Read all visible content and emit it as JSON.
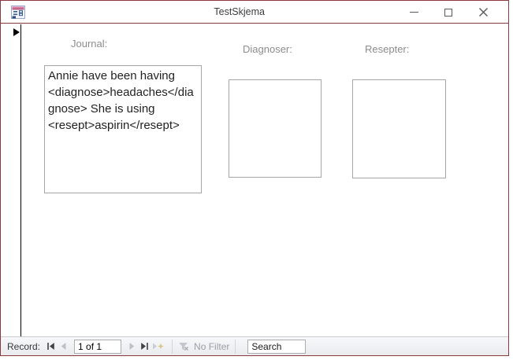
{
  "window": {
    "title": "TestSkjema",
    "controls": {
      "minimize": "minimize",
      "maximize": "maximize",
      "close": "close"
    }
  },
  "form": {
    "journal": {
      "label": "Journal:",
      "value": "Annie have been having <diagnose>headaches</diagnose> She is using <resept>aspirin</resept>"
    },
    "diagnoser": {
      "label": "Diagnoser:",
      "items": []
    },
    "resepter": {
      "label": "Resepter:",
      "items": []
    }
  },
  "record_navigation": {
    "record_label": "Record:",
    "current_record": "1 of 1",
    "filter_status": "No Filter",
    "search_placeholder": "Search"
  },
  "icons": {
    "app_icon": "access-form-icon",
    "record_selector": "right-arrow-icon",
    "nav_buttons": [
      "first-record-icon",
      "previous-record-icon",
      "next-record-icon",
      "last-record-icon",
      "new-record-icon"
    ],
    "filter": "funnel-x-icon"
  },
  "colors": {
    "window_border": "#8a3a3e",
    "label_text": "#8c8c8c",
    "box_border": "#a6a6a6",
    "navbar_gradient_top": "#f7f8fa",
    "navbar_gradient_bottom": "#e9ebee",
    "enabled_glyph": "#3f4347",
    "disabled_glyph": "#bcc0c6",
    "new_record_star": "#d9c283"
  }
}
